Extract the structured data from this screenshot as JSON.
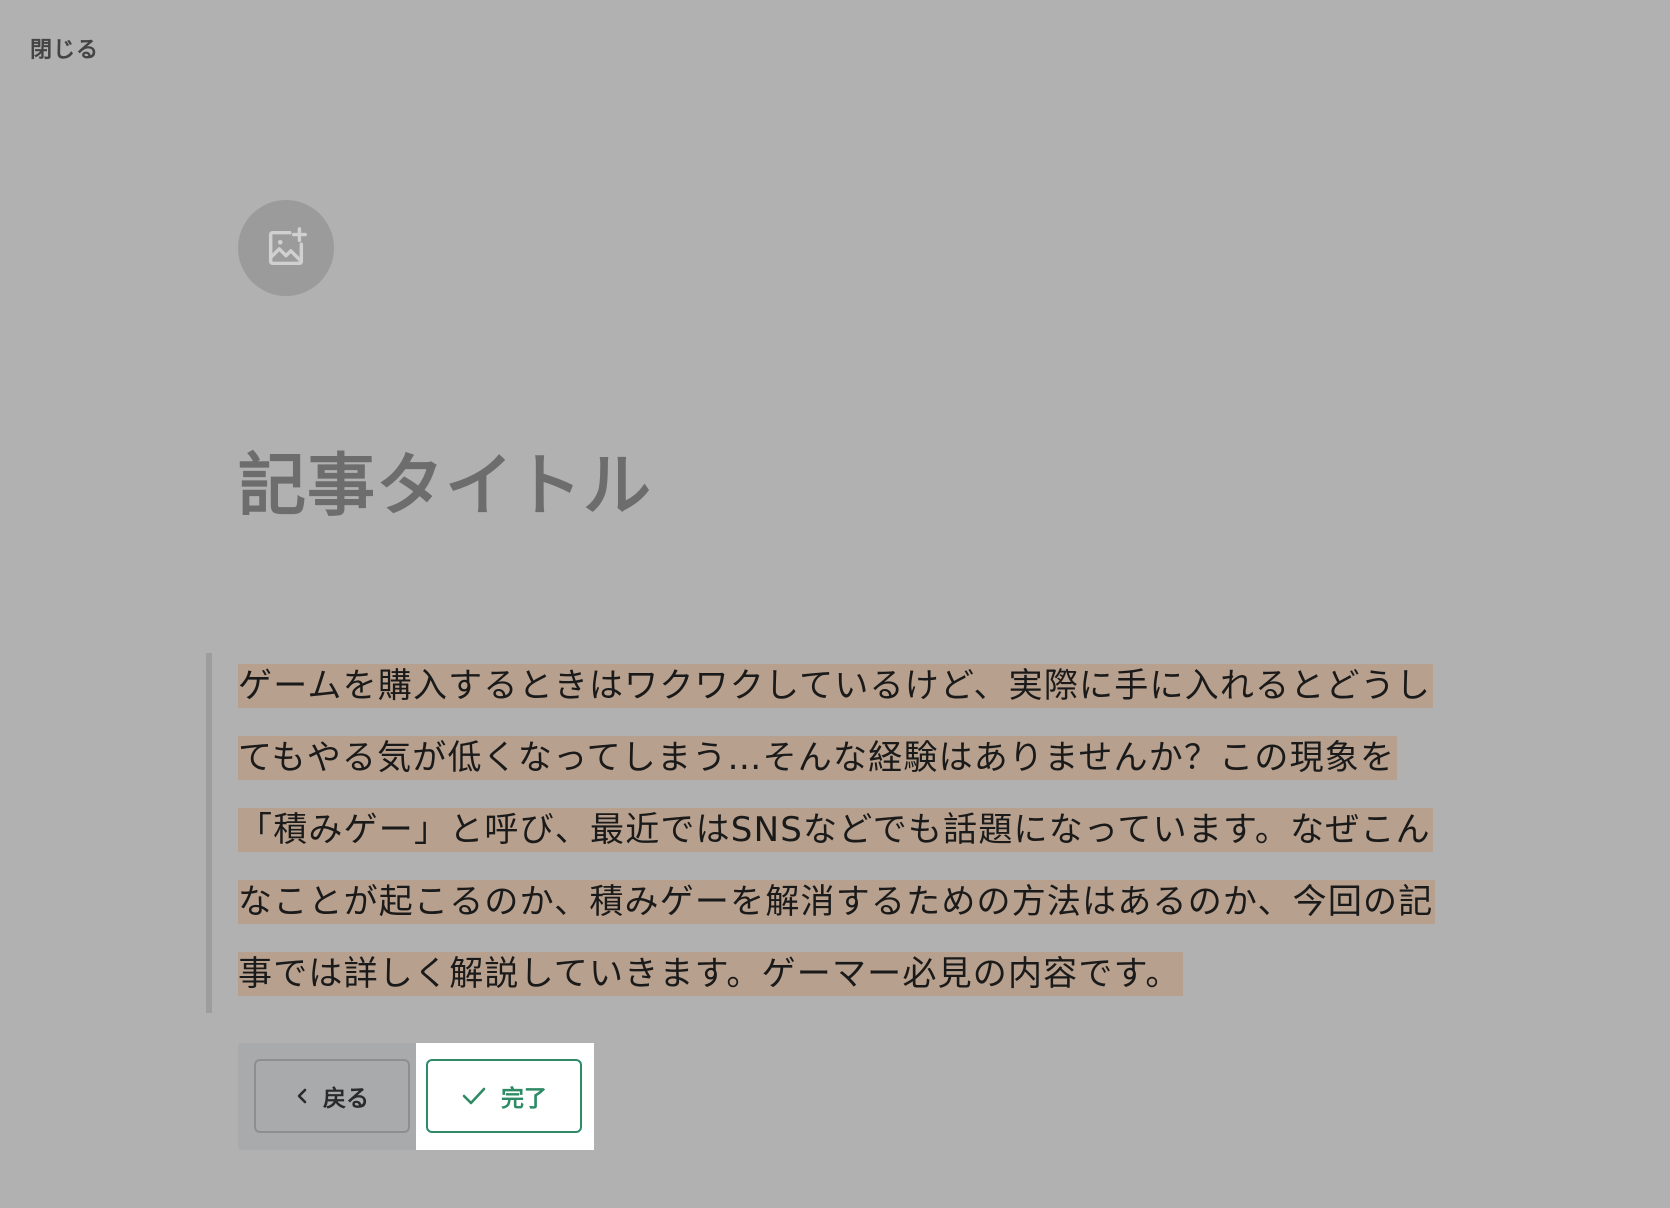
{
  "header": {
    "close_label": "閉じる"
  },
  "cover": {
    "icon": "image-plus-icon"
  },
  "article": {
    "title": "記事タイトル",
    "body_lines": [
      "ゲームを購入するときはワクワクしているけど、実際に手に入れるとどうし",
      "てもやる気が低くなってしまう…そんな経験はありませんか？この現象を",
      "「積みゲー」と呼び、最近ではSNSなどでも話題になっています。なぜこん",
      "なことが起こるのか、積みゲーを解消するための方法はあるのか、今回の記",
      "事では詳しく解説していきます。ゲーマー必見の内容です。"
    ]
  },
  "actions": {
    "back_label": "戻る",
    "back_icon": "chevron-left-icon",
    "done_label": "完了",
    "done_icon": "check-icon"
  },
  "colors": {
    "overlay": "#b1b1b1",
    "highlight": "#b7a08d",
    "accent": "#2e8b66"
  }
}
